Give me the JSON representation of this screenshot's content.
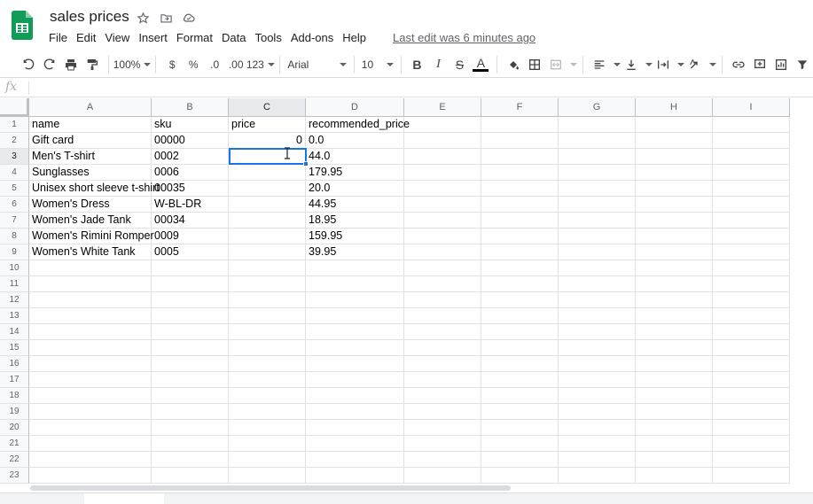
{
  "header": {
    "title": "sales prices",
    "menu": [
      "File",
      "Edit",
      "View",
      "Insert",
      "Format",
      "Data",
      "Tools",
      "Add-ons",
      "Help"
    ],
    "last_edit": "Last edit was 6 minutes ago",
    "icons": [
      "star-icon",
      "move-to-folder-icon",
      "cloud-status-icon"
    ]
  },
  "toolbar": {
    "zoom": "100%",
    "currency": "$",
    "percent": "%",
    "decrease_decimal": ".0",
    "increase_decimal": ".00",
    "more_formats": "123",
    "font": "Arial",
    "font_size": "10",
    "bold": "B",
    "italic": "I",
    "strike": "S",
    "text_color_letter": "A",
    "text_color": "#000000"
  },
  "formula_bar": {
    "fx": "fx",
    "value": ""
  },
  "grid": {
    "columns": [
      "A",
      "B",
      "C",
      "D",
      "E",
      "F",
      "G",
      "H",
      "I"
    ],
    "selected_column": "C",
    "selected_row": "3",
    "row_numbers": [
      "1",
      "2",
      "3",
      "4",
      "5",
      "6",
      "7",
      "8",
      "9",
      "10",
      "11",
      "12",
      "13",
      "14",
      "15",
      "16",
      "17",
      "18",
      "19",
      "20",
      "21",
      "22",
      "23"
    ],
    "rows": [
      [
        "name",
        "sku",
        "price",
        "recommended_price"
      ],
      [
        "Gift card",
        "00000",
        "0",
        "0.0"
      ],
      [
        "Men's T-shirt",
        "0002",
        "",
        "44.0"
      ],
      [
        "Sunglasses",
        "0006",
        "",
        "179.95"
      ],
      [
        "Unisex short sleeve t-shirt",
        "00035",
        "",
        "20.0"
      ],
      [
        "Women's Dress",
        "W-BL-DR",
        "",
        "44.95"
      ],
      [
        "Women's Jade Tank",
        "00034",
        "",
        "18.95"
      ],
      [
        "Women's Rimini Romper",
        "0009",
        "",
        "159.95"
      ],
      [
        "Women's White Tank",
        "0005",
        "",
        "39.95"
      ]
    ]
  },
  "colors": {
    "selection": "#1a73e8",
    "header_bg": "#f8f9fa",
    "sheets_green": "#0f9d58"
  }
}
